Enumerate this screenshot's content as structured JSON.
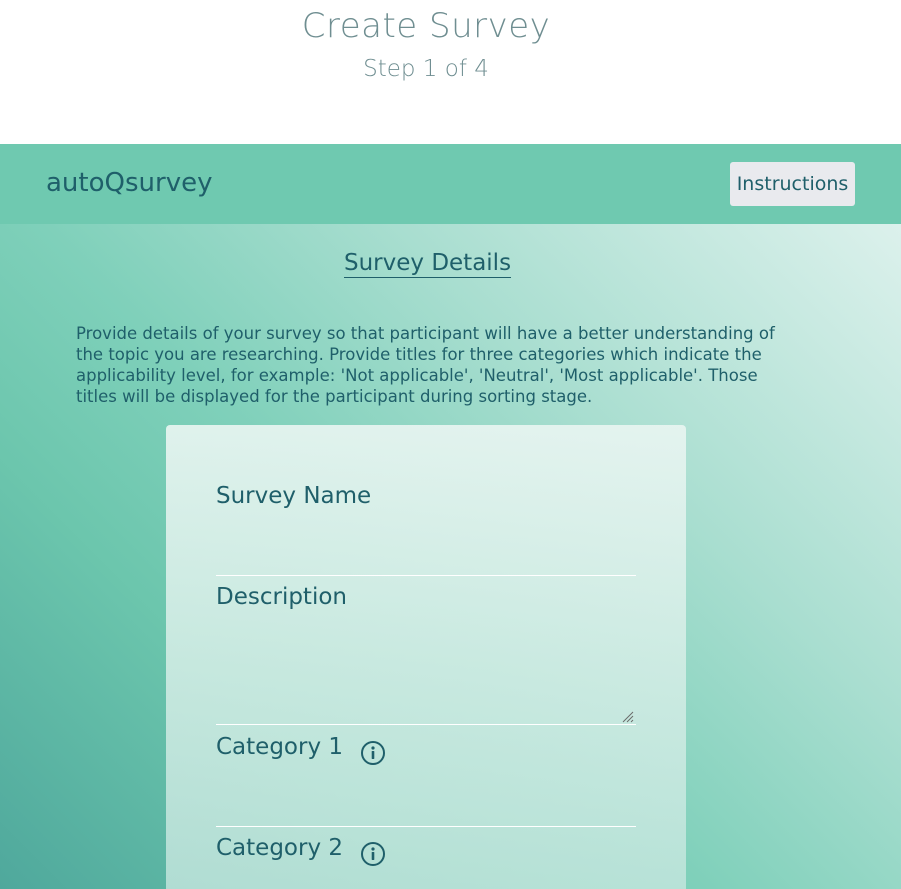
{
  "header": {
    "title": "Create Survey",
    "step": "Step 1 of 4"
  },
  "navbar": {
    "brand": "autoQsurvey",
    "instructions_label": "Instructions"
  },
  "main": {
    "section_title": "Survey Details",
    "description": "Provide details of your survey so that participant will have a better understanding of the topic you are researching. Provide titles for three categories which indicate the applicability level, for example: 'Not applicable', 'Neutral', 'Most applicable'. Those titles will be displayed for the participant during sorting stage."
  },
  "form": {
    "survey_name": {
      "label": "Survey Name",
      "value": ""
    },
    "description": {
      "label": "Description",
      "value": ""
    },
    "category1": {
      "label": "Category 1",
      "value": "",
      "icon": "info-icon"
    },
    "category2": {
      "label": "Category 2",
      "value": "",
      "icon": "info-icon"
    }
  },
  "colors": {
    "navbar": "#6fc9b0",
    "text": "#1f5f6a",
    "title": "#6f8e91",
    "button_bg": "#e9eaee"
  }
}
